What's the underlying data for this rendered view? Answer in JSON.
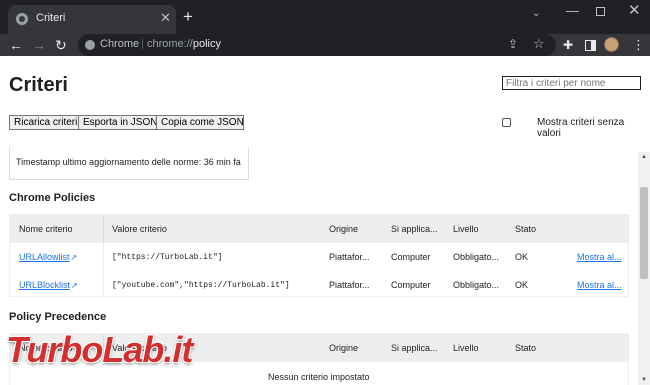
{
  "browser": {
    "tab_title": "Criteri",
    "omnibox_chrome_label": "Chrome",
    "omnibox_separator": "|",
    "url_scheme": "chrome://",
    "url_path": "policy"
  },
  "page": {
    "title": "Criteri",
    "filter_placeholder": "Filtra i criteri per nome",
    "buttons": {
      "reload": "Ricarica criteri",
      "export_json": "Esporta in JSON",
      "copy_json": "Copia come JSON"
    },
    "show_no_value_label": "Mostra criteri senza valori",
    "show_no_value_checked": false,
    "timestamp_text": "Timestamp ultimo aggiornamento delle norme: 36 min fa"
  },
  "chrome_policies": {
    "title": "Chrome Policies",
    "headers": [
      "Nome criterio",
      "Valore criterio",
      "Origine",
      "Si applica...",
      "Livello",
      "Stato"
    ],
    "rows": [
      {
        "name": "URLAllowlist",
        "value": "[\"https://TurboLab.it\"]",
        "source": "Piattafor...",
        "applies": "Computer",
        "level": "Obbligato...",
        "status": "OK",
        "action": "Mostra al..."
      },
      {
        "name": "URLBlocklist",
        "value": "[\"youtube.com\",\"https://TurboLab.it\"]",
        "source": "Piattafor...",
        "applies": "Computer",
        "level": "Obbligato...",
        "status": "OK",
        "action": "Mostra al..."
      }
    ]
  },
  "policy_precedence": {
    "title": "Policy Precedence",
    "headers": [
      "Nome criterio",
      "Valore criterio",
      "Origine",
      "Si applica...",
      "Livello",
      "Stato"
    ],
    "empty_message": "Nessun criterio impostato"
  },
  "watermark": {
    "text_main": "Turbo",
    "text_lab": "Lab.it"
  },
  "colors": {
    "link": "#1a73e8",
    "watermark": "#d32f2f",
    "chrome_dark": "#202124"
  }
}
